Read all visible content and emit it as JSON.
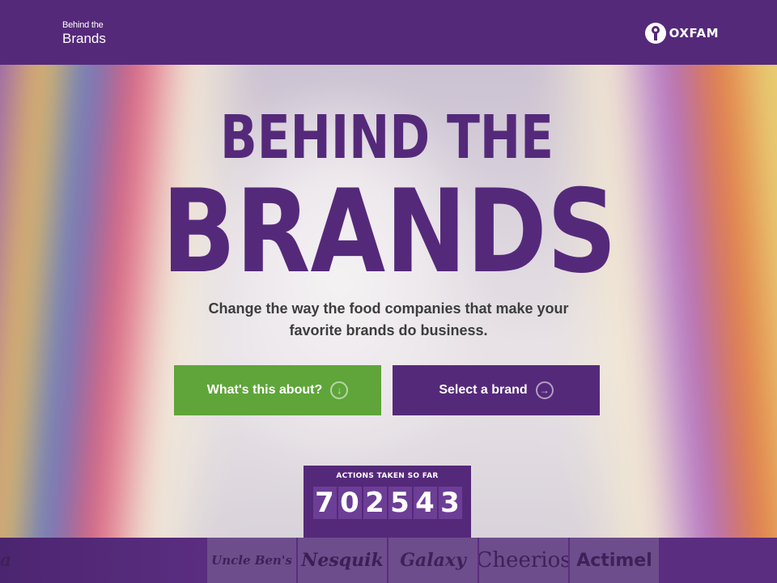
{
  "header": {
    "title_small": "Behind the",
    "title_big": "Brands",
    "org_logo_text": "OXFAM"
  },
  "hero": {
    "headline_line1": "BEHIND THE",
    "headline_line2": "BRANDS",
    "tagline_line1": "Change the way the food companies that make your",
    "tagline_line2": "favorite brands do business."
  },
  "buttons": {
    "about_label": "What's this about?",
    "about_icon": "arrow-down-circle-icon",
    "brand_label": "Select a brand",
    "brand_icon": "arrow-right-circle-icon"
  },
  "counter": {
    "label": "ACTIONS TAKEN SO FAR",
    "digits": [
      "7",
      "0",
      "2",
      "5",
      "4",
      "3"
    ]
  },
  "brand_strip": {
    "partial_left": "a",
    "brands": [
      "Uncle Ben's",
      "Nesquik",
      "Galaxy",
      "Cheerios",
      "Actimel"
    ]
  },
  "colors": {
    "brand_purple": "#55297a",
    "button_green": "#5fa53a",
    "tagline_text": "#3d3d3d"
  }
}
